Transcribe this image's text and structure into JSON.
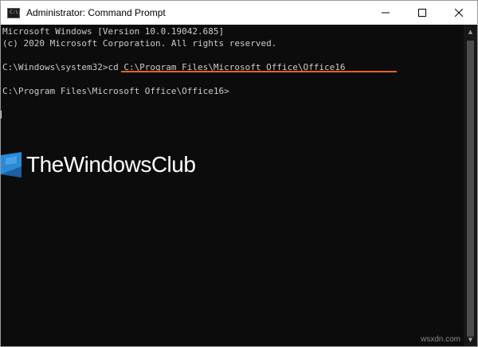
{
  "window": {
    "title": "Administrator: Command Prompt",
    "app_icon_label": "C:\\."
  },
  "console": {
    "lines": [
      "Microsoft Windows [Version 10.0.19042.685]",
      "(c) 2020 Microsoft Corporation. All rights reserved.",
      "",
      "C:\\Windows\\system32>cd C:\\Program Files\\Microsoft Office\\Office16",
      "",
      "C:\\Program Files\\Microsoft Office\\Office16>"
    ]
  },
  "logo": {
    "text": "TheWindowsClub"
  },
  "watermark": "wsxdn.com",
  "colors": {
    "underline": "#e8651a",
    "console_bg": "#0c0c0c",
    "console_text": "#cccccc",
    "logo_blue": "#2b8ad8"
  },
  "icons": [
    "cmd-app-icon",
    "minimize-icon",
    "maximize-icon",
    "close-icon",
    "scroll-up-icon",
    "scroll-down-icon",
    "thewindowsclub-logo-icon"
  ]
}
